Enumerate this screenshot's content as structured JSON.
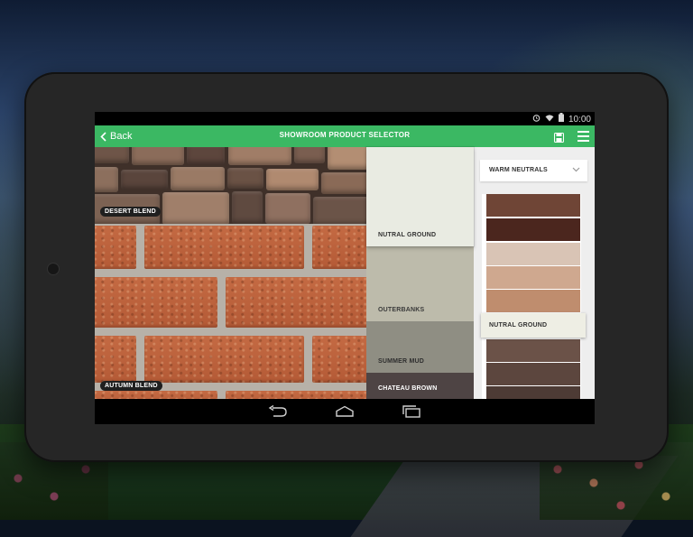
{
  "status_bar": {
    "time": "10:00",
    "icons": [
      "alarm-icon",
      "wifi-icon",
      "battery-icon"
    ]
  },
  "app_bar": {
    "back_label": "Back",
    "title": "SHOWROOM PRODUCT SELECTOR",
    "icons": [
      "save-icon",
      "menu-icon"
    ],
    "color": "#3bb863"
  },
  "products": [
    {
      "name": "DESERT BLEND"
    },
    {
      "name": "AUTUMN BLEND"
    }
  ],
  "swatches": [
    {
      "label": "NUTRAL GROUND",
      "color": "#e9ebe2",
      "text_color": "#333333",
      "selected": true
    },
    {
      "label": "OUTERBANKS",
      "color": "#bdbbab",
      "text_color": "#3a3a3a",
      "selected": false
    },
    {
      "label": "SUMMER MUD",
      "color": "#8f8e83",
      "text_color": "#2e2e2e",
      "selected": false
    },
    {
      "label": "CHATEAU BROWN",
      "color": "#4e4444",
      "text_color": "#ffffff",
      "selected": false
    }
  ],
  "palette": {
    "selected_option": "WARM NEUTRALS",
    "highlight_label": "NUTRAL GROUND",
    "chips": [
      "#6f4536",
      "#4b261e",
      "#d9c4b5",
      "#cfa88f",
      "#bf8d6e",
      "#6b5248",
      "#5c463e",
      "#4d3b35"
    ]
  },
  "nav_bar": {
    "icons": [
      "back-nav-icon",
      "home-nav-icon",
      "recents-nav-icon"
    ]
  }
}
